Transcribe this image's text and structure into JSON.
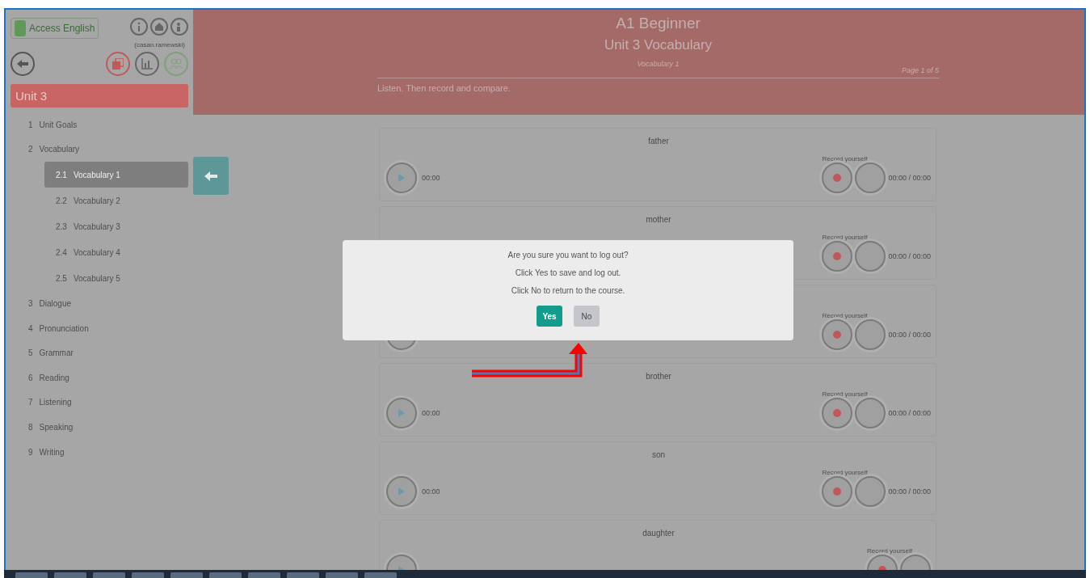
{
  "sidebar": {
    "logo_text": "Access English",
    "username": "(casan.ramewski)",
    "unit_title": "Unit 3",
    "items": [
      {
        "number": "1",
        "label": "Unit Goals",
        "selected": false
      },
      {
        "number": "2",
        "label": "Vocabulary",
        "selected": false,
        "children": [
          {
            "number": "2.1",
            "label": "Vocabulary 1",
            "selected": true
          },
          {
            "number": "2.2",
            "label": "Vocabulary 2",
            "selected": false
          },
          {
            "number": "2.3",
            "label": "Vocabulary 3",
            "selected": false
          },
          {
            "number": "2.4",
            "label": "Vocabulary 4",
            "selected": false
          },
          {
            "number": "2.5",
            "label": "Vocabulary 5",
            "selected": false
          }
        ]
      },
      {
        "number": "3",
        "label": "Dialogue",
        "selected": false
      },
      {
        "number": "4",
        "label": "Pronunciation",
        "selected": false
      },
      {
        "number": "5",
        "label": "Grammar",
        "selected": false
      },
      {
        "number": "6",
        "label": "Reading",
        "selected": false
      },
      {
        "number": "7",
        "label": "Listening",
        "selected": false
      },
      {
        "number": "8",
        "label": "Speaking",
        "selected": false
      },
      {
        "number": "9",
        "label": "Writing",
        "selected": false
      }
    ]
  },
  "header": {
    "level": "A1 Beginner",
    "unit": "Unit 3 Vocabulary",
    "section": "Vocabulary 1",
    "page": "Page 1 of 5",
    "instruction": "Listen. Then record and compare."
  },
  "rows": [
    {
      "word": "father",
      "kind": "full",
      "time": "00:00",
      "record_label": "Record yourself",
      "record_time": "00:00 / 00:00"
    },
    {
      "word": "mother",
      "kind": "covered",
      "record_label": "Record yourself",
      "record_time": "00:00 / 00:00"
    },
    {
      "kind": "rim",
      "record_label": "Record yourself",
      "record_time": "00:00 / 00:00"
    },
    {
      "word": "brother",
      "kind": "full",
      "time": "00:00",
      "record_label": "Record yourself",
      "record_time": "00:00 / 00:00"
    },
    {
      "word": "son",
      "kind": "full",
      "time": "00:00",
      "record_label": "Record yourself",
      "record_time": "00:00 / 00:00"
    },
    {
      "word": "daughter",
      "kind": "full",
      "record_label": "Record yourself"
    }
  ],
  "dialog": {
    "lines": [
      "Are you sure you want to log out?",
      "Click Yes to save and log out.",
      "Click No to return to the course."
    ],
    "buttons": [
      {
        "label": "Yes",
        "kind": "primary"
      },
      {
        "label": "No",
        "kind": "secondary"
      }
    ]
  }
}
